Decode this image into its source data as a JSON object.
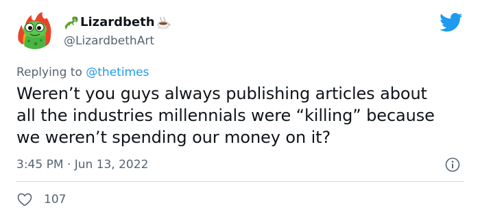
{
  "tweet": {
    "author": {
      "display_name": "Lizardbeth",
      "handle": "@LizardbethArt",
      "name_emojis": [
        "lizard-emoji",
        "hot-beverage-emoji"
      ]
    },
    "reply": {
      "prefix": "Replying to",
      "mention": "@thetimes"
    },
    "text_lines": [
      "Weren’t you guys always publishing articles about",
      "all the industries millennials were “killing” because",
      "we weren’t spending our money on it?"
    ],
    "timestamp": "3:45 PM · Jun 13, 2022",
    "likes": "107",
    "icons": {
      "brand": "twitter-bird-icon",
      "info": "info-icon",
      "like": "heart-icon"
    }
  },
  "colors": {
    "text_primary": "#0f1419",
    "text_secondary": "#536471",
    "accent_blue": "#1d9bf0",
    "divider": "#cfd9de"
  }
}
